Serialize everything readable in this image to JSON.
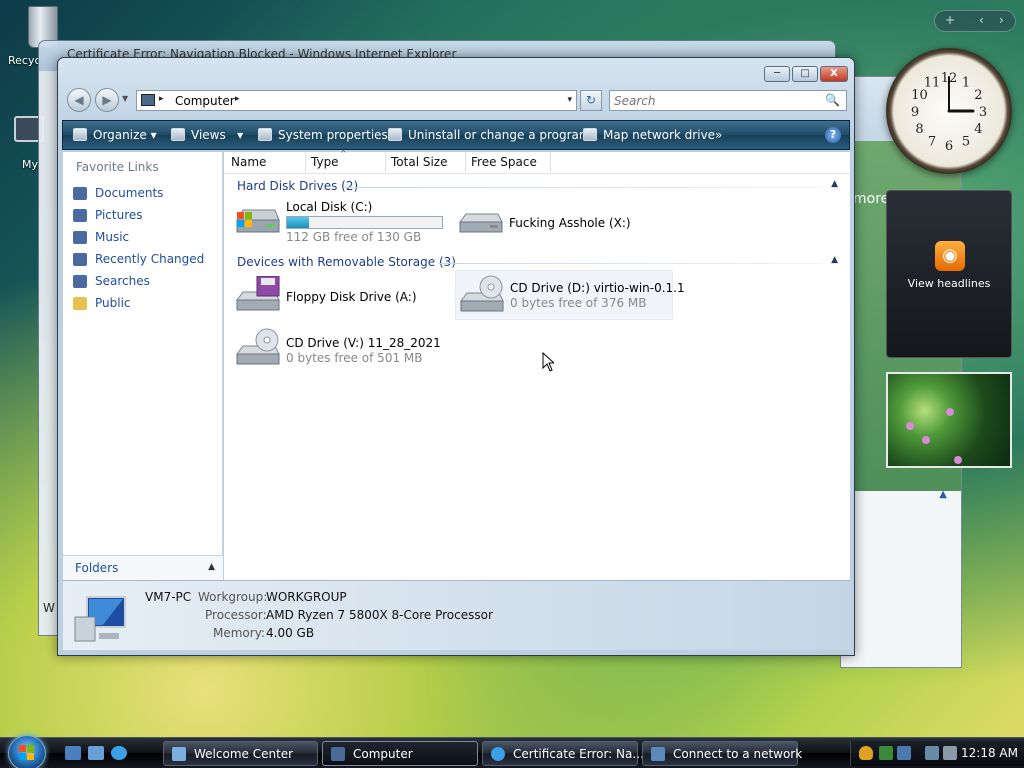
{
  "desktop": {
    "recycle_label": "Recyc",
    "mycomp_label": "My"
  },
  "background_window": {
    "title": "Certificate Error: Navigation Blocked - Windows Internet Explorer",
    "left_text": "W",
    "side_text": "more"
  },
  "gadgets": {
    "bar": {
      "add": "+",
      "prev": "‹",
      "next": "›"
    },
    "clock": {
      "hour": 3,
      "minute": 60
    },
    "rss": {
      "label": "View headlines",
      "icon": "rss-icon"
    },
    "slideshow": {
      "icon": "photo-icon"
    }
  },
  "window": {
    "caption": {
      "min": "─",
      "max": "□",
      "close": "X"
    },
    "nav": {
      "back": "◀",
      "forward": "▶"
    },
    "address": {
      "crumb": "Computer",
      "arrow": "▸",
      "dropdown": "▾"
    },
    "refresh": "↻",
    "search": {
      "placeholder": "Search",
      "icon": "🔍"
    },
    "toolbar": {
      "organize": "Organize",
      "views": "Views",
      "system_properties": "System properties",
      "uninstall": "Uninstall or change a program",
      "map_drive": "Map network drive",
      "more": "»",
      "help": "?"
    },
    "nav_pane": {
      "header": "Favorite Links",
      "links": [
        {
          "label": "Documents",
          "icon": "documents-icon",
          "color": "#4a6aa0"
        },
        {
          "label": "Pictures",
          "icon": "pictures-icon",
          "color": "#4a6aa0"
        },
        {
          "label": "Music",
          "icon": "music-icon",
          "color": "#4a6aa0"
        },
        {
          "label": "Recently Changed",
          "icon": "recent-icon",
          "color": "#4a6aa0"
        },
        {
          "label": "Searches",
          "icon": "searches-icon",
          "color": "#4a6aa0"
        },
        {
          "label": "Public",
          "icon": "public-folder-icon",
          "color": "#e3c250"
        }
      ],
      "folders": "Folders",
      "folders_chevron": "▲"
    },
    "columns": {
      "name": "Name",
      "type": "Type",
      "total_size": "Total Size",
      "free_space": "Free Space",
      "sort": "^"
    },
    "groups": {
      "hdd": {
        "label": "Hard Disk Drives (2)",
        "chevron": "▲"
      },
      "removable": {
        "label": "Devices with Removable Storage (3)",
        "chevron": "▲"
      }
    },
    "drives": {
      "c": {
        "name": "Local Disk (C:)",
        "sub": "112 GB free of 130 GB",
        "used_fraction": 0.14
      },
      "x": {
        "name": "Fucking Asshole (X:)"
      },
      "a": {
        "name": "Floppy Disk Drive (A:)"
      },
      "d": {
        "name": "CD Drive (D:) virtio-win-0.1.1",
        "sub": "0 bytes free of 376 MB"
      },
      "v": {
        "name": "CD Drive (V:) 11_28_2021",
        "sub": "0 bytes free of 501 MB"
      }
    },
    "details": {
      "computer_name": "VM7-PC",
      "workgroup_label": "Workgroup:",
      "workgroup": "WORKGROUP",
      "processor_label": "Processor:",
      "processor": "AMD Ryzen 7 5800X 8-Core Processor",
      "memory_label": "Memory:",
      "memory": "4.00 GB"
    }
  },
  "taskbar": {
    "tasks": [
      {
        "label": "Welcome Center",
        "icon": "welcome-center-icon"
      },
      {
        "label": "Computer",
        "icon": "computer-icon"
      },
      {
        "label": "Certificate Error: Na...",
        "icon": "ie-icon"
      },
      {
        "label": "Connect to a network",
        "icon": "network-icon"
      }
    ],
    "time": "12:18 AM"
  }
}
